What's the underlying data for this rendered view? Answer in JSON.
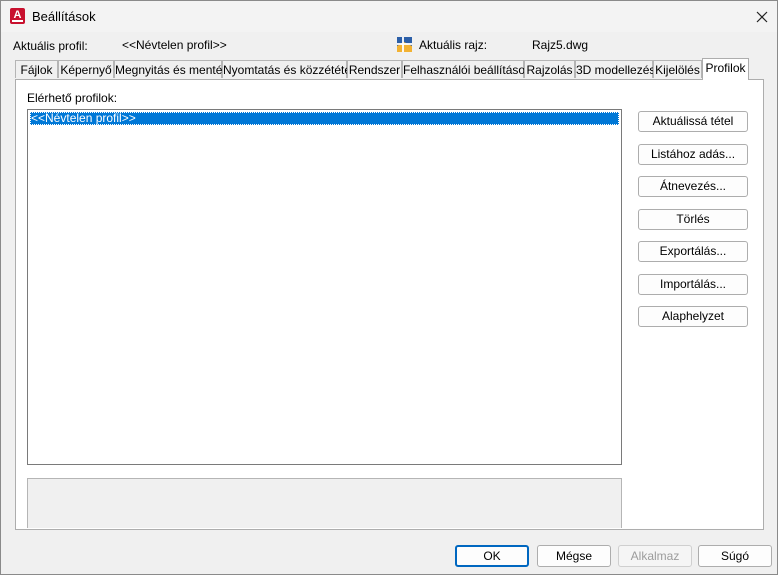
{
  "window": {
    "title": "Beállítások"
  },
  "info": {
    "profile_label": "Aktuális profil:",
    "profile_value": "<<Névtelen profil>>",
    "drawing_label": "Aktuális rajz:",
    "drawing_value": "Rajz5.dwg"
  },
  "tabs": [
    {
      "label": "Fájlok"
    },
    {
      "label": "Képernyő"
    },
    {
      "label": "Megnyitás és mentés"
    },
    {
      "label": "Nyomtatás és közzététel"
    },
    {
      "label": "Rendszer"
    },
    {
      "label": "Felhasználói beállítások"
    },
    {
      "label": "Rajzolás"
    },
    {
      "label": "3D modellezés"
    },
    {
      "label": "Kijelölés"
    },
    {
      "label": "Profilok",
      "active": true
    }
  ],
  "profiles": {
    "list_label": "Elérhető profilok:",
    "items": [
      "<<Névtelen profil>>"
    ],
    "selected_index": 0
  },
  "actions": {
    "set_current": "Aktuálissá tétel",
    "add_to_list": "Listához adás...",
    "rename": "Átnevezés...",
    "delete": "Törlés",
    "export": "Exportálás...",
    "import": "Importálás...",
    "reset": "Alaphelyzet"
  },
  "footer": {
    "ok": "OK",
    "cancel": "Mégse",
    "apply": "Alkalmaz",
    "help": "Súgó"
  },
  "colors": {
    "selection": "#0078d7",
    "app_icon": "#c8102e",
    "default_button_border": "#0067c0"
  }
}
